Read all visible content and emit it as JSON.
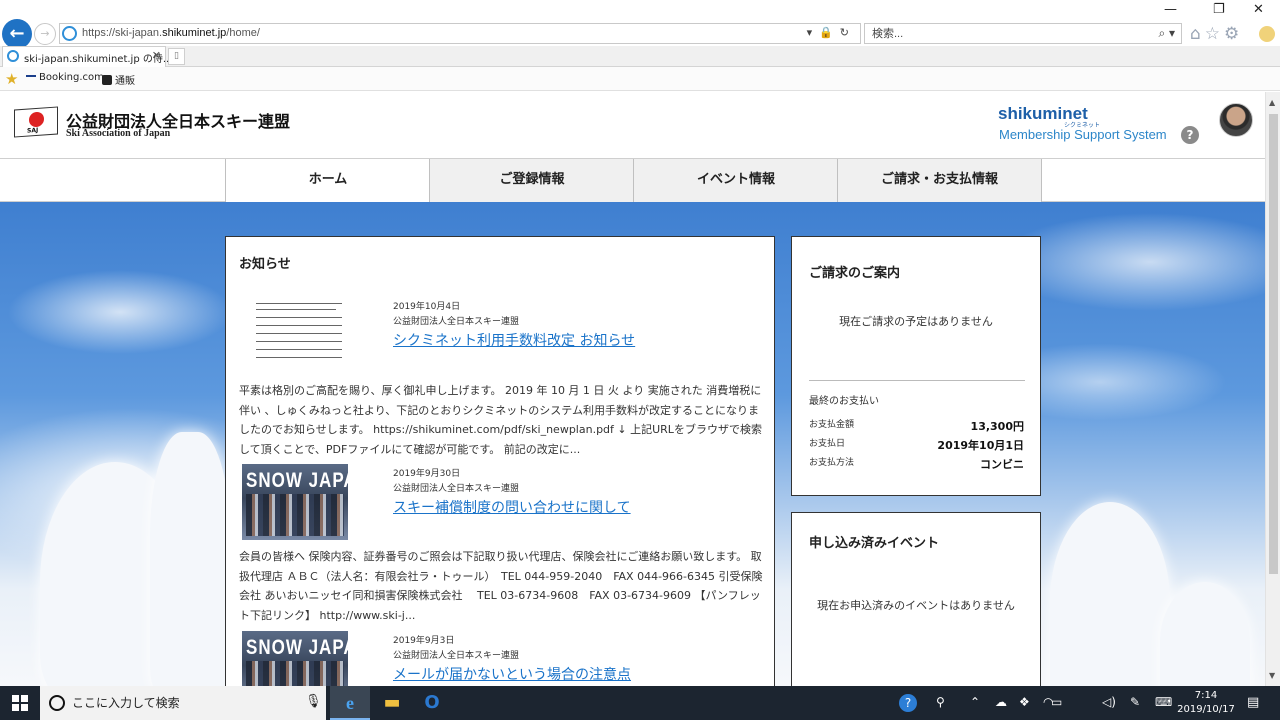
{
  "browser": {
    "url_prefix": "https://ski-japan.",
    "url_domain": "shikuminet.jp",
    "url_path": "/home/",
    "address_tools": "▾🔒↻",
    "search_placeholder": "検索...",
    "search_icon": "⌕ ▾",
    "toolbar_icons": "⌂☆⚙",
    "window_controls": {
      "minimize": "—",
      "restore": "❐",
      "close": "✕"
    },
    "tab": {
      "label": "ski-japan.shikuminet.jp の侍...",
      "close": "✕"
    },
    "favorites": [
      {
        "label": "Booking.com",
        "icon": "booking-icon"
      },
      {
        "label": "通販",
        "icon": "amazon-icon"
      }
    ]
  },
  "header": {
    "org_name_jp": "公益財団法人全日本スキー連盟",
    "org_name_en": "Ski Association of Japan",
    "logo_text": "SAJ",
    "brand": "shikuminet",
    "brand_kana": "シクミネット",
    "system_name": "Membership Support System",
    "help": "?"
  },
  "nav": {
    "items": [
      {
        "label": "ホーム",
        "active": true
      },
      {
        "label": "ご登録情報",
        "active": false
      },
      {
        "label": "イベント情報",
        "active": false
      },
      {
        "label": "ご請求・お支払情報",
        "active": false
      }
    ]
  },
  "news": {
    "title": "お知らせ",
    "items": [
      {
        "date": "2019年10月4日",
        "org": "公益財団法人全日本スキー連盟",
        "title": "シクミネット利用手数料改定 お知らせ",
        "thumb": "document",
        "body": "平素は格別のご高配を賜り、厚く御礼申し上げます。 2019 年 10 月 1 日 火 より 実施された 消費増税に伴い 、しゅくみねっと社より、下記のとおりシクミネットのシステム利用手数料が改定することになりましたのでお知らせします。 https://shikuminet.com/pdf/ski_newplan.pdf ↓ 上記URLをブラウザで検索して頂くことで、PDFファイルにて確認が可能です。 前記の改定に..."
      },
      {
        "date": "2019年9月30日",
        "org": "公益財団法人全日本スキー連盟",
        "title": "スキー補償制度の問い合わせに関して",
        "thumb": "SNOW JAPAN",
        "body": "会員の皆様へ 保険内容、証券番号のご照会は下記取り扱い代理店、保険会社にご連絡お願い致します。 取扱代理店 ＡＢＣ（法人名：有限会社ラ・トゥール）　TEL 044-959-2040　FAX 044-966-6345 引受保険会社 あいおいニッセイ同和損害保険株式会社　 TEL 03-6734-9608　FAX 03-6734-9609 【パンフレット下記リンク】 http://www.ski-j..."
      },
      {
        "date": "2019年9月3日",
        "org": "公益財団法人全日本スキー連盟",
        "title": "メールが届かないという場合の注意点",
        "thumb": "SNOW JAPAN"
      }
    ]
  },
  "billing": {
    "title": "ご請求のご案内",
    "none_message": "現在ご請求の予定はありません",
    "last_payment_title": "最終のお支払い",
    "amount_label": "お支払金額",
    "amount_value": "13,300円",
    "date_label": "お支払日",
    "date_value": "2019年10月1日",
    "method_label": "お支払方法",
    "method_value": "コンビニ"
  },
  "events": {
    "title": "申し込み済みイベント",
    "none_message": "現在お申込済みのイベントはありません"
  },
  "taskbar": {
    "search_placeholder": "ここに入力して検索",
    "time": "7:14",
    "date": "2019/10/17",
    "tray_icons": [
      "help-icon",
      "people-icon",
      "chevron-up-icon",
      "cloud-icon",
      "dropbox-icon",
      "network-icon",
      "volume-icon",
      "pen-icon",
      "keyboard-icon"
    ]
  }
}
